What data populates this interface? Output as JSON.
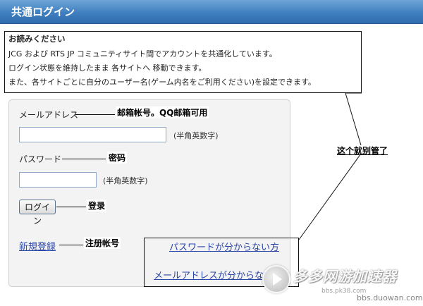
{
  "header": {
    "title": "共通ログイン"
  },
  "notice": {
    "heading": "お読みください",
    "lines": [
      "JCG および RTS JP コミュニティサイト間でアカウントを共通化しています。",
      "ログイン状態を維持したまま 各サイトへ 移動できます。",
      "また、各サイトごとに自分のユーザー名(ゲーム内名をご利用ください)を設定できます。"
    ]
  },
  "form": {
    "email_label": "メールアドレス",
    "email_value": "",
    "email_hint": "(半角英数字)",
    "password_label": "パスワード",
    "password_value": "",
    "password_hint": "(半角英数字)",
    "login_button": "ログイン",
    "register_link": "新規登録",
    "forgot_password_link": "パスワードが分からない方",
    "forgot_email_link": "メールアドレスが分からない方"
  },
  "annotations": {
    "email": "邮箱帐号。QQ邮箱可用",
    "password": "密码",
    "login": "登录",
    "register": "注册帐号",
    "ignore": "这个就别管了"
  },
  "watermark": {
    "title": "多多网游加速器",
    "url_small": "bbs.pk38.com",
    "url": "bbs.duowan.com"
  },
  "colors": {
    "titlebar": "#3f7fbf",
    "link": "#2a45a8",
    "panel_bg": "#f3f3f3"
  }
}
